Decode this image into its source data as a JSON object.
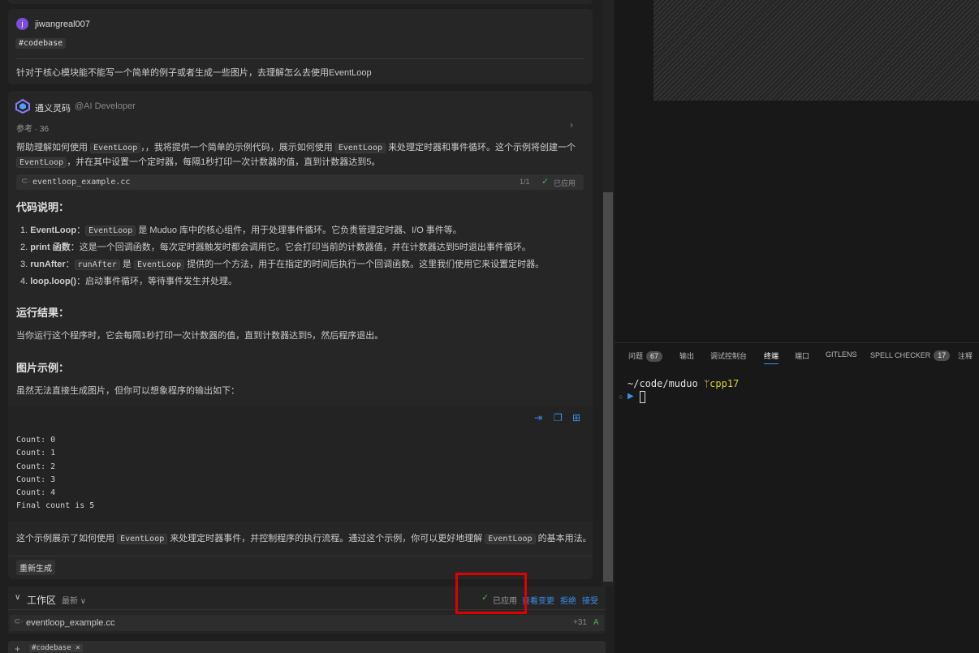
{
  "user_msg": {
    "avatar": "j",
    "name": "jiwangreal007",
    "tag": "#codebase",
    "text": "针对于核心模块能不能写一个简单的例子或者生成一些图片，去理解怎么去使用EventLoop"
  },
  "ai": {
    "name": "通义灵码",
    "role": "@AI Developer",
    "refs": "参考 · 36",
    "intro_a": "帮助理解如何使用",
    "intro_code1": "EventLoop",
    "intro_b": "，我将提供一个简单的示例代码，展示如何使用",
    "intro_code2": "EventLoop",
    "intro_c": "来处理定时器和事件循环。这个示例将创建一个",
    "intro2_code": "EventLoop",
    "intro2_a": "，并在其中设置一个定时器，每隔1秒打印一次计数器的值，直到计数器达到5。",
    "file_name": "eventloop_example.cc",
    "file_count": "1/1",
    "file_status": "已应用",
    "h_code": "代码说明：",
    "l1_num": "1.",
    "l1_b": "EventLoop",
    "l1_colon": "：",
    "l1_code": "EventLoop",
    "l1_text": "是 Muduo 库中的核心组件，用于处理事件循环。它负责管理定时器、I/O 事件等。",
    "l2_num": "2.",
    "l2_b": "print 函数",
    "l2_text": "：这是一个回调函数，每次定时器触发时都会调用它。它会打印当前的计数器值，并在计数器达到5时退出事件循环。",
    "l3_num": "3.",
    "l3_b": "runAfter",
    "l3_colon": "：",
    "l3_code": "runAfter",
    "l3_mid": "是",
    "l3_code2": "EventLoop",
    "l3_text": "提供的一个方法，用于在指定的时间后执行一个回调函数。这里我们使用它来设置定时器。",
    "l4_num": "4.",
    "l4_b": "loop.loop()",
    "l4_text": "：启动事件循环，等待事件发生并处理。",
    "h_run": "运行结果：",
    "run_text": "当你运行这个程序时，它会每隔1秒打印一次计数器的值，直到计数器达到5，然后程序退出。",
    "h_img": "图片示例：",
    "img_text": "虽然无法直接生成图片，但你可以想象程序的输出如下：",
    "output": [
      "Count: 0",
      "Count: 1",
      "Count: 2",
      "Count: 3",
      "Count: 4",
      "Final count is 5"
    ],
    "outro_a": "这个示例展示了如何使用",
    "outro_code": "EventLoop",
    "outro_b": "来处理定时器事件，并控制程序的执行流程。通过这个示例，你可以更好地理解",
    "outro_code2": "EventLoop",
    "outro_c": "的基本用法。",
    "regen": "重新生成"
  },
  "workspace": {
    "title": "工作区",
    "sort": "最新",
    "status": "已应用",
    "view": "查看变更",
    "reject": "拒绝",
    "accept": "接受",
    "file": "eventloop_example.cc",
    "diff": "+31",
    "flag": "A"
  },
  "input": {
    "tag": "#codebase"
  },
  "panel": {
    "tabs": [
      {
        "label": "问题",
        "badge": "67"
      },
      {
        "label": "输出"
      },
      {
        "label": "调试控制台"
      },
      {
        "label": "终端"
      },
      {
        "label": "端口"
      },
      {
        "label": "GITLENS"
      },
      {
        "label": "SPELL CHECKER",
        "badge": "17"
      },
      {
        "label": "注释"
      }
    ]
  },
  "terminal": {
    "path": "~/code/muduo",
    "branch": "cpp17"
  },
  "colors": {
    "accent": "#3b8eea",
    "highlight": "#e00000",
    "avatar": "#7c4ddb"
  }
}
